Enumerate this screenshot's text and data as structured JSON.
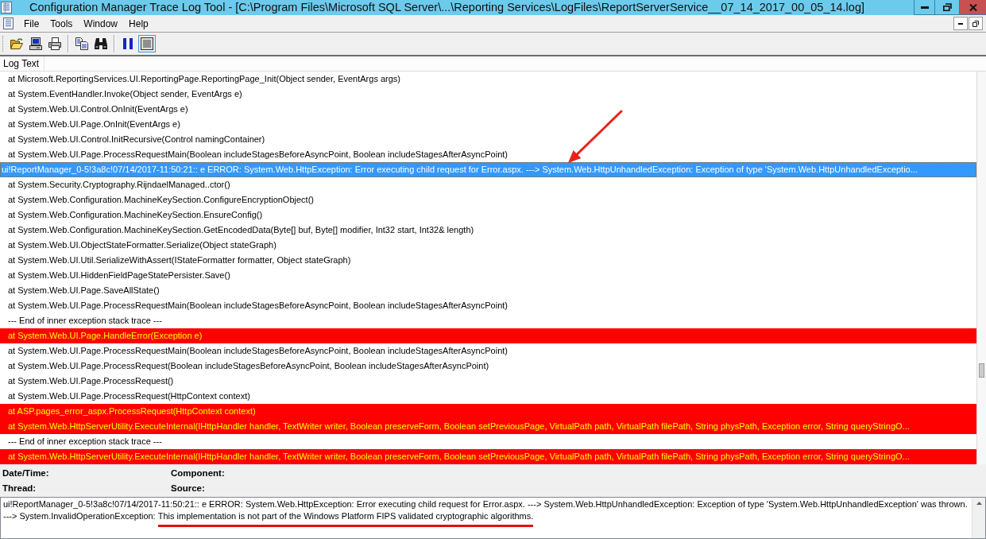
{
  "window": {
    "title": "Configuration Manager Trace Log Tool - [C:\\Program Files\\Microsoft SQL Server\\...\\Reporting Services\\LogFiles\\ReportServerService__07_14_2017_00_05_14.log]"
  },
  "menu": [
    "File",
    "Tools",
    "Window",
    "Help"
  ],
  "toolbar": {
    "groups": [
      {
        "buttons": [
          {
            "kind": "open",
            "on": false
          },
          {
            "kind": "computer",
            "on": false
          },
          {
            "kind": "print",
            "on": false
          }
        ]
      },
      {
        "buttons": [
          {
            "kind": "copy",
            "on": false
          },
          {
            "kind": "find",
            "on": false
          }
        ]
      },
      {
        "buttons": [
          {
            "kind": "pause",
            "on": false
          },
          {
            "kind": "view",
            "on": true
          }
        ]
      }
    ]
  },
  "log": {
    "column": "Log Text",
    "rows": [
      {
        "kind": "stack",
        "text": "at Microsoft.ReportingServices.UI.ReportingPage.ReportingPage_Init(Object sender, EventArgs args)",
        "selected": false,
        "error": false
      },
      {
        "kind": "stack",
        "text": "at System.EventHandler.Invoke(Object sender, EventArgs e)",
        "selected": false,
        "error": false
      },
      {
        "kind": "stack",
        "text": "at System.Web.UI.Control.OnInit(EventArgs e)",
        "selected": false,
        "error": false
      },
      {
        "kind": "stack",
        "text": "at System.Web.UI.Page.OnInit(EventArgs e)",
        "selected": false,
        "error": false
      },
      {
        "kind": "stack",
        "text": "at System.Web.UI.Control.InitRecursive(Control namingContainer)",
        "selected": false,
        "error": false
      },
      {
        "kind": "stack",
        "text": "at System.Web.UI.Page.ProcessRequestMain(Boolean includeStagesBeforeAsyncPoint, Boolean includeStagesAfterAsyncPoint)",
        "selected": false,
        "error": false
      },
      {
        "kind": "message",
        "text": "ui!ReportManager_0-5!3a8c!07/14/2017-11:50:21:: e ERROR: System.Web.HttpException: Error executing child request for Error.aspx. ---> System.Web.HttpUnhandledException: Exception of type 'System.Web.HttpUnhandledExceptio...",
        "selected": true,
        "error": false
      },
      {
        "kind": "stack",
        "text": "at System.Security.Cryptography.RijndaelManaged..ctor()",
        "selected": false,
        "error": false
      },
      {
        "kind": "stack",
        "text": "at System.Web.Configuration.MachineKeySection.ConfigureEncryptionObject()",
        "selected": false,
        "error": false
      },
      {
        "kind": "stack",
        "text": "at System.Web.Configuration.MachineKeySection.EnsureConfig()",
        "selected": false,
        "error": false
      },
      {
        "kind": "stack",
        "text": "at System.Web.Configuration.MachineKeySection.GetEncodedData(Byte[] buf, Byte[] modifier, Int32 start, Int32& length)",
        "selected": false,
        "error": false
      },
      {
        "kind": "stack",
        "text": "at System.Web.UI.ObjectStateFormatter.Serialize(Object stateGraph)",
        "selected": false,
        "error": false
      },
      {
        "kind": "stack",
        "text": "at System.Web.UI.Util.SerializeWithAssert(IStateFormatter formatter, Object stateGraph)",
        "selected": false,
        "error": false
      },
      {
        "kind": "stack",
        "text": "at System.Web.UI.HiddenFieldPageStatePersister.Save()",
        "selected": false,
        "error": false
      },
      {
        "kind": "stack",
        "text": "at System.Web.UI.Page.SaveAllState()",
        "selected": false,
        "error": false
      },
      {
        "kind": "stack",
        "text": "at System.Web.UI.Page.ProcessRequestMain(Boolean includeStagesBeforeAsyncPoint, Boolean includeStagesAfterAsyncPoint)",
        "selected": false,
        "error": false
      },
      {
        "kind": "stack",
        "text": "--- End of inner exception stack trace ---",
        "selected": false,
        "error": false
      },
      {
        "kind": "stack",
        "text": "at System.Web.UI.Page.HandleError(Exception e)",
        "selected": false,
        "error": true
      },
      {
        "kind": "stack",
        "text": "at System.Web.UI.Page.ProcessRequestMain(Boolean includeStagesBeforeAsyncPoint, Boolean includeStagesAfterAsyncPoint)",
        "selected": false,
        "error": false
      },
      {
        "kind": "stack",
        "text": "at System.Web.UI.Page.ProcessRequest(Boolean includeStagesBeforeAsyncPoint, Boolean includeStagesAfterAsyncPoint)",
        "selected": false,
        "error": false
      },
      {
        "kind": "stack",
        "text": "at System.Web.UI.Page.ProcessRequest()",
        "selected": false,
        "error": false
      },
      {
        "kind": "stack",
        "text": "at System.Web.UI.Page.ProcessRequest(HttpContext context)",
        "selected": false,
        "error": false
      },
      {
        "kind": "stack",
        "text": "at ASP.pages_error_aspx.ProcessRequest(HttpContext context)",
        "selected": false,
        "error": true
      },
      {
        "kind": "stack",
        "text": "at System.Web.HttpServerUtility.ExecuteInternal(IHttpHandler handler, TextWriter writer, Boolean preserveForm, Boolean setPreviousPage, VirtualPath path, VirtualPath filePath, String physPath, Exception error, String queryStringO...",
        "selected": false,
        "error": true
      },
      {
        "kind": "stack",
        "text": "--- End of inner exception stack trace ---",
        "selected": false,
        "error": false
      },
      {
        "kind": "stack",
        "text": "at System.Web.HttpServerUtility.ExecuteInternal(IHttpHandler handler, TextWriter writer, Boolean preserveForm, Boolean setPreviousPage, VirtualPath path, VirtualPath filePath, String physPath, Exception error, String queryStringO...",
        "selected": false,
        "error": true
      }
    ]
  },
  "details": {
    "fields": [
      {
        "label": "Date/Time:"
      },
      {
        "label": "Component:"
      },
      {
        "label": "Thread:"
      },
      {
        "label": "Source:"
      }
    ],
    "message": [
      {
        "text": "ui!ReportManager_0-5!3a8c!07/14/2017-11:50:21:: e ERROR: System.Web.HttpException: Error executing child request for Error.aspx. ---> System.Web.HttpUnhandledException: Exception of type 'System.Web.HttpUnhandledException' was thrown.\n---> System.InvalidOperationException: ",
        "underlined": false
      },
      {
        "text": "This implementation is not part of the Windows Platform FIPS validated cryptographic algorithms.",
        "underlined": true
      }
    ]
  }
}
